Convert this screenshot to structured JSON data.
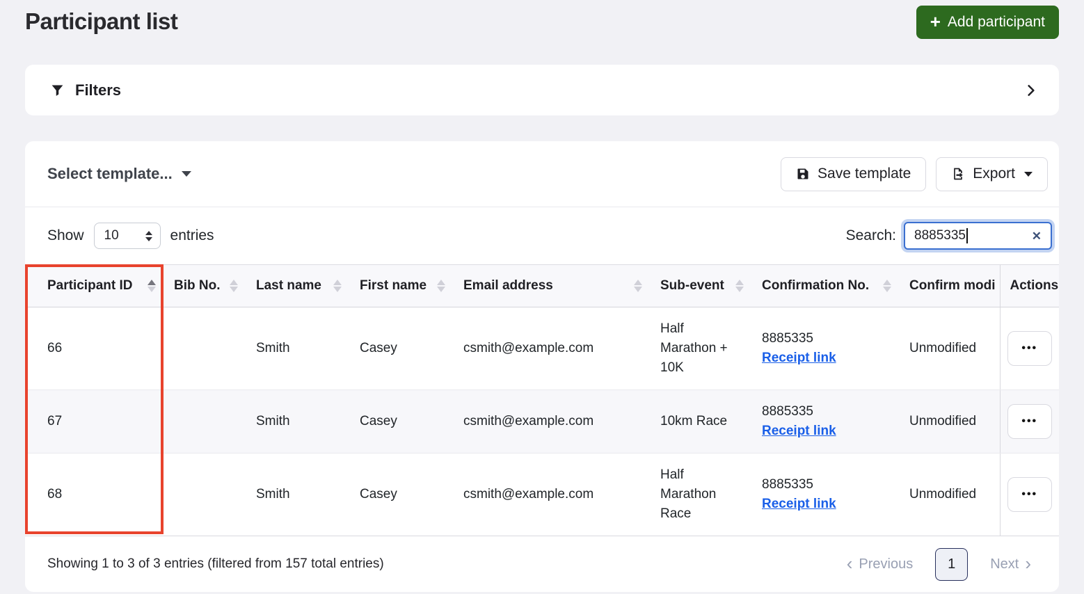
{
  "page": {
    "title": "Participant list"
  },
  "header": {
    "add_participant_label": "Add participant"
  },
  "filters": {
    "label": "Filters"
  },
  "toolbar": {
    "select_template_label": "Select template...",
    "save_template_label": "Save template",
    "export_label": "Export"
  },
  "controls": {
    "show_label": "Show",
    "page_size": "10",
    "entries_label": "entries",
    "search_label": "Search:",
    "search_value": "8885335"
  },
  "table": {
    "columns": [
      {
        "label": "Participant ID",
        "sort": "asc"
      },
      {
        "label": "Bib No.",
        "sort": "none"
      },
      {
        "label": "Last name",
        "sort": "none"
      },
      {
        "label": "First name",
        "sort": "none"
      },
      {
        "label": "Email address",
        "sort": "none"
      },
      {
        "label": "Sub-event",
        "sort": "none"
      },
      {
        "label": "Confirmation No.",
        "sort": "none"
      },
      {
        "label": "Confirm modi",
        "sort": "none"
      },
      {
        "label": "Actions",
        "sort": "none"
      }
    ],
    "rows": [
      {
        "participant_id": "66",
        "bib_no": "",
        "last_name": "Smith",
        "first_name": "Casey",
        "email": "csmith@example.com",
        "sub_event": "Half Marathon + 10K",
        "confirmation_no": "8885335",
        "receipt_link_label": "Receipt link",
        "confirm_modified": "Unmodified"
      },
      {
        "participant_id": "67",
        "bib_no": "",
        "last_name": "Smith",
        "first_name": "Casey",
        "email": "csmith@example.com",
        "sub_event": "10km Race",
        "confirmation_no": "8885335",
        "receipt_link_label": "Receipt link",
        "confirm_modified": "Unmodified"
      },
      {
        "participant_id": "68",
        "bib_no": "",
        "last_name": "Smith",
        "first_name": "Casey",
        "email": "csmith@example.com",
        "sub_event": "Half Marathon Race",
        "confirmation_no": "8885335",
        "receipt_link_label": "Receipt link",
        "confirm_modified": "Unmodified"
      }
    ]
  },
  "footer": {
    "summary": "Showing 1 to 3 of 3 entries (filtered from 157 total entries)",
    "pagination": {
      "previous_label": "Previous",
      "current_page": "1",
      "next_label": "Next"
    }
  },
  "icons": {
    "plus": "+",
    "ellipsis": "•••",
    "clear": "✕",
    "prev_chevron": "‹",
    "next_chevron": "›"
  },
  "colors": {
    "accent_green": "#2d6a1f",
    "highlight_red": "#e8432d",
    "link_blue": "#1a5fe8",
    "search_focus_blue": "#3a6fd0"
  }
}
